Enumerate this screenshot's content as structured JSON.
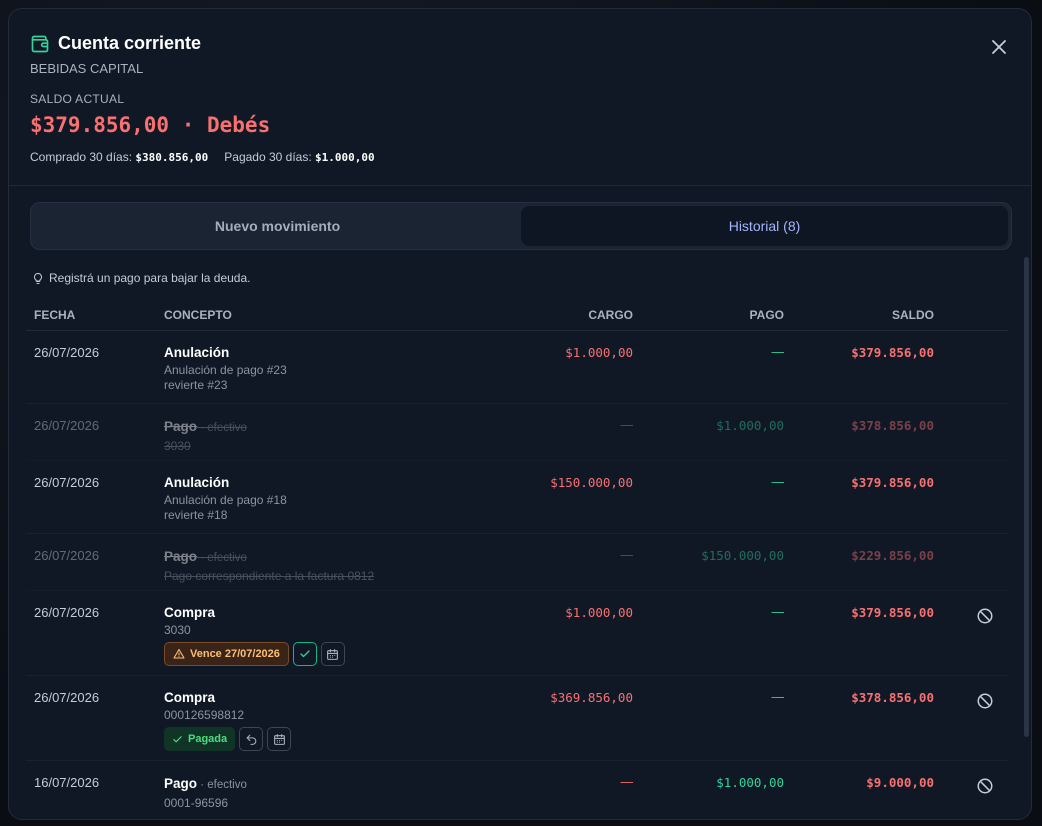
{
  "modal": {
    "title": "Cuenta corriente",
    "subtitle": "BEBIDAS CAPITAL",
    "saldo_label": "SALDO ACTUAL",
    "saldo_value": "$379.856,00 · Debés",
    "stats": {
      "comprado_label": "Comprado 30 días:",
      "comprado_value": "$380.856,00",
      "pagado_label": "Pagado 30 días:",
      "pagado_value": "$1.000,00"
    }
  },
  "tabs": [
    {
      "label": "Nuevo movimiento",
      "active": false
    },
    {
      "label": "Historial (8)",
      "active": true
    }
  ],
  "hint": "Registrá un pago para bajar la deuda.",
  "table": {
    "headers": {
      "fecha": "FECHA",
      "concepto": "CONCEPTO",
      "cargo": "CARGO",
      "pago": "PAGO",
      "saldo": "SALDO"
    },
    "rows": [
      {
        "fecha": "26/07/2026",
        "title": "Anulación",
        "method": "",
        "lines": [
          "Anulación de pago #23",
          "revierte #23"
        ],
        "cargo": "$1.000,00",
        "pago": "—",
        "saldo": "$379.856,00"
      },
      {
        "fecha": "26/07/2026",
        "title": "Pago",
        "method": " · efectivo",
        "lines": [
          "3030"
        ],
        "cargo": "—",
        "pago": "$1.000,00",
        "saldo": "$378.856,00"
      },
      {
        "fecha": "26/07/2026",
        "title": "Anulación",
        "method": "",
        "lines": [
          "Anulación de pago #18",
          "revierte #18"
        ],
        "cargo": "$150.000,00",
        "pago": "—",
        "saldo": "$379.856,00"
      },
      {
        "fecha": "26/07/2026",
        "title": "Pago",
        "method": " · efectivo",
        "lines": [
          "Pago correspondiente a la factura 0812"
        ],
        "cargo": "—",
        "pago": "$150.000,00",
        "saldo": "$229.856,00"
      },
      {
        "fecha": "26/07/2026",
        "title": "Compra",
        "method": "",
        "lines": [
          "3030"
        ],
        "badge": "Vence 27/07/2026",
        "cargo": "$1.000,00",
        "pago": "—",
        "saldo": "$379.856,00"
      },
      {
        "fecha": "26/07/2026",
        "title": "Compra",
        "method": "",
        "lines": [
          "000126598812"
        ],
        "badge": "Pagada",
        "cargo": "$369.856,00",
        "pago": "—",
        "saldo": "$378.856,00"
      },
      {
        "fecha": "16/07/2026",
        "title": "Pago",
        "method": " · efectivo",
        "lines": [
          "0001-96596"
        ],
        "cargo": "—",
        "pago": "$1.000,00",
        "saldo": "$9.000,00"
      }
    ]
  },
  "colors": {
    "accent": "#a5b4fc",
    "debt": "#f87171",
    "credit": "#34d399",
    "brand": "#34d399"
  }
}
